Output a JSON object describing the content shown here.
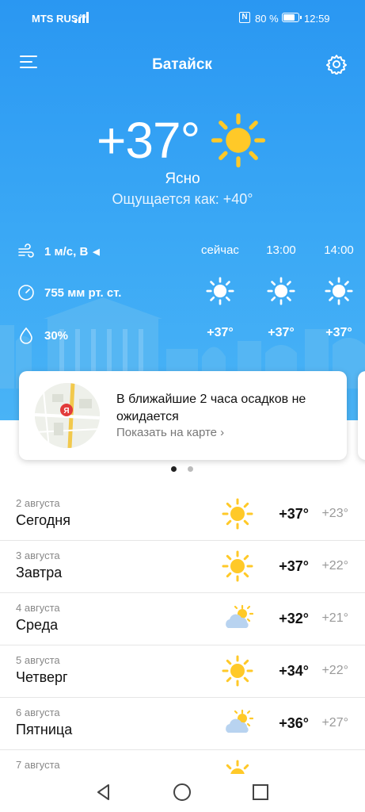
{
  "status_bar": {
    "carrier": "MTS RUS",
    "network": "4G",
    "battery_percent": "80 %",
    "battery_level": 0.8,
    "time": "12:59"
  },
  "header": {
    "city": "Батайск",
    "menu_icon": "hamburger-menu-icon",
    "settings_icon": "gear-icon"
  },
  "current": {
    "temperature": "+37°",
    "condition": "Ясно",
    "feels_like": "Ощущается как: +40°",
    "icon": "sun-icon",
    "wind": "1 м/с, В",
    "pressure": "755 мм рт. ст.",
    "humidity": "30%"
  },
  "hourly": [
    {
      "label": "сейчас",
      "temp": "+37°",
      "icon": "sun-icon"
    },
    {
      "label": "13:00",
      "temp": "+37°",
      "icon": "sun-icon"
    },
    {
      "label": "14:00",
      "temp": "+37°",
      "icon": "sun-icon"
    }
  ],
  "precipitation_card": {
    "text": "В ближайшие 2 часа осадков не ожидается",
    "link": "Показать на карте ›"
  },
  "pager": {
    "count": 2,
    "active": 0
  },
  "forecast": [
    {
      "date": "2 августа",
      "day": "Сегодня",
      "hi": "+37°",
      "lo": "+23°",
      "icon": "sun-icon"
    },
    {
      "date": "3 августа",
      "day": "Завтра",
      "hi": "+37°",
      "lo": "+22°",
      "icon": "sun-icon"
    },
    {
      "date": "4 августа",
      "day": "Среда",
      "hi": "+32°",
      "lo": "+21°",
      "icon": "partly-cloudy-icon"
    },
    {
      "date": "5 августа",
      "day": "Четверг",
      "hi": "+34°",
      "lo": "+22°",
      "icon": "sun-icon"
    },
    {
      "date": "6 августа",
      "day": "Пятница",
      "hi": "+36°",
      "lo": "+27°",
      "icon": "partly-cloudy-icon"
    },
    {
      "date": "7 августа",
      "day": "",
      "hi": "",
      "lo": "",
      "icon": "sun-icon"
    }
  ],
  "colors": {
    "sky_top": "#2a97f2",
    "sky_bottom": "#49b3f6",
    "sun": "#ffc928",
    "cloud": "#b8d3f0"
  },
  "nav": {
    "back_icon": "back-triangle-icon",
    "home_icon": "home-circle-icon",
    "recents_icon": "recents-square-icon"
  }
}
